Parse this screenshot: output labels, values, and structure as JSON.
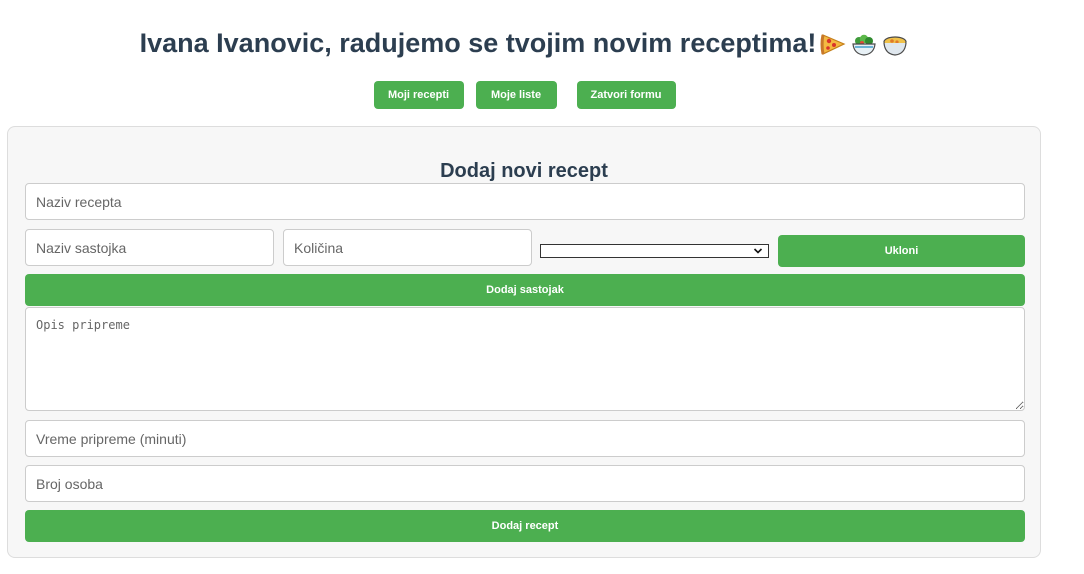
{
  "header": {
    "title": "Ivana Ivanovic, radujemo se tvojim novim receptima!",
    "emojis": [
      "pizza-icon",
      "salad-icon",
      "bowl-icon"
    ]
  },
  "nav": {
    "my_recipes": "Moji recepti",
    "my_lists": "Moje liste",
    "close_form": "Zatvori formu"
  },
  "form": {
    "title": "Dodaj novi recept",
    "recipe_name_placeholder": "Naziv recepta",
    "ingredient_name_placeholder": "Naziv sastojka",
    "quantity_placeholder": "Količina",
    "unit_selected": "",
    "remove_label": "Ukloni",
    "add_ingredient_label": "Dodaj sastojak",
    "description_placeholder": "Opis pripreme",
    "prep_time_placeholder": "Vreme pripreme (minuti)",
    "servings_placeholder": "Broj osoba",
    "add_recipe_label": "Dodaj recept"
  },
  "colors": {
    "accent": "#4caf50",
    "title": "#2c3e50",
    "panel_bg": "#f7f7f7"
  }
}
